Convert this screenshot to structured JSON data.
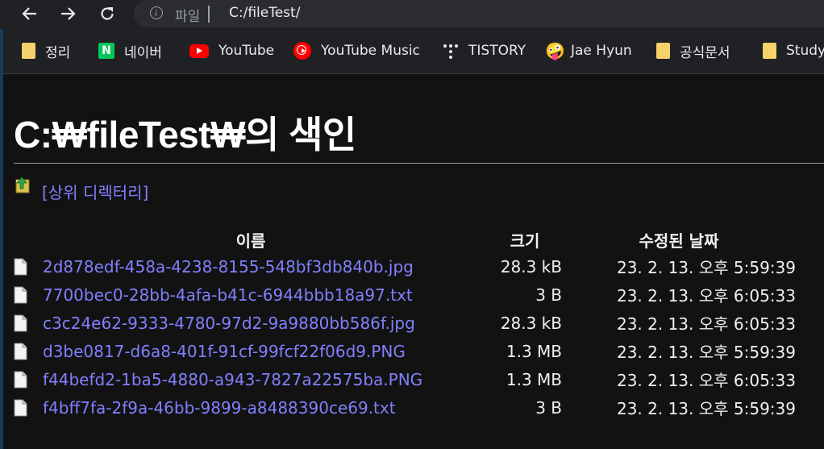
{
  "toolbar": {
    "omnibox_label": "파일",
    "url": "C:/fileTest/"
  },
  "bookmarks": [
    {
      "label": "정리",
      "icon": "folder-icon"
    },
    {
      "label": "네이버",
      "icon": "naver-icon",
      "icon_text": "N"
    },
    {
      "label": "YouTube",
      "icon": "youtube-icon"
    },
    {
      "label": "YouTube Music",
      "icon": "youtube-music-icon"
    },
    {
      "label": "TISTORY",
      "icon": "tistory-icon"
    },
    {
      "label": "Jae Hyun",
      "icon": "emoji-face-icon",
      "icon_text": "🤪"
    },
    {
      "label": "공식문서",
      "icon": "folder-icon"
    },
    {
      "label": "Study",
      "icon": "folder-icon"
    }
  ],
  "page": {
    "title": "C:₩fileTest₩의 색인",
    "parent_link": "[상위 디렉터리]",
    "columns": {
      "name": "이름",
      "size": "크기",
      "modified": "수정된 날짜"
    },
    "files": [
      {
        "name": "2d878edf-458a-4238-8155-548bf3db840b.jpg",
        "size": "28.3 kB",
        "modified": "23. 2. 13. 오후 5:59:39"
      },
      {
        "name": "7700bec0-28bb-4afa-b41c-6944bbb18a97.txt",
        "size": "3 B",
        "modified": "23. 2. 13. 오후 6:05:33"
      },
      {
        "name": "c3c24e62-9333-4780-97d2-9a9880bb586f.jpg",
        "size": "28.3 kB",
        "modified": "23. 2. 13. 오후 6:05:33"
      },
      {
        "name": "d3be0817-d6a8-401f-91cf-99fcf22f06d9.PNG",
        "size": "1.3 MB",
        "modified": "23. 2. 13. 오후 5:59:39"
      },
      {
        "name": "f44befd2-1ba5-4880-a943-7827a22575ba.PNG",
        "size": "1.3 MB",
        "modified": "23. 2. 13. 오후 6:05:33"
      },
      {
        "name": "f4bff7fa-2f9a-46bb-9899-a8488390ce69.txt",
        "size": "3 B",
        "modified": "23. 2. 13. 오후 5:59:39"
      }
    ]
  },
  "colors": {
    "link": "#8080ff",
    "background": "#121212",
    "toolbar": "#202124"
  }
}
